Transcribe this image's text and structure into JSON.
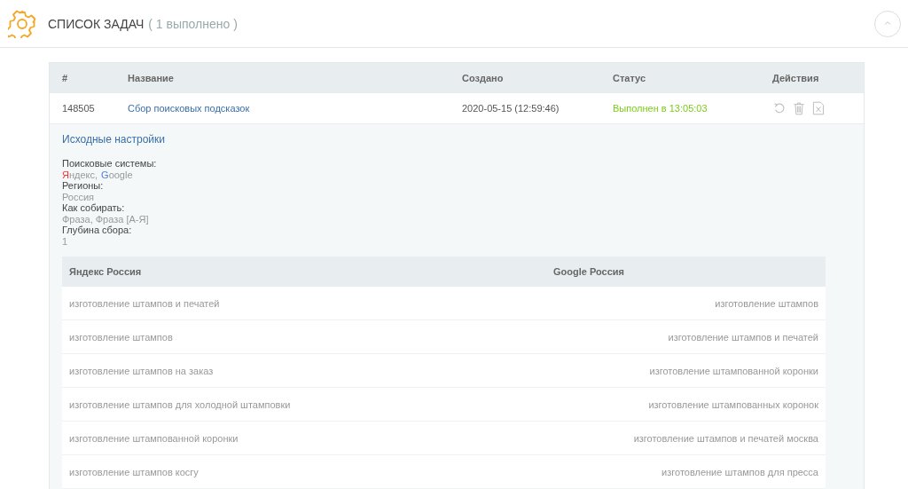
{
  "header": {
    "title": "СПИСОК ЗАДАЧ",
    "count": "( 1 выполнено )",
    "collapse_button": {
      "kind": "up"
    }
  },
  "tasks": {
    "columns": [
      "#",
      "Название",
      "Создано",
      "Статус",
      "Действия"
    ],
    "rows": [
      {
        "id": "148505",
        "name": "Сбор поисковых подсказок",
        "created": "2020-05-15 (12:59:46)",
        "status": {
          "text": "Выполнен в 13:05:03",
          "kind": "done"
        },
        "expanded": true,
        "details": {
          "heading": "Исходные настройки",
          "settings": [
            {
              "label": "Поисковые системы:",
              "kind": "engines",
              "engines": [
                {
                  "initial": "Я",
                  "rest": "ндекс,",
                  "color": "#ff3333"
                },
                {
                  "initial": "G",
                  "rest": "oogle",
                  "color": "#4a7fd8"
                }
              ]
            },
            {
              "label": "Регионы:",
              "kind": "text",
              "value": "Россия"
            },
            {
              "label": "Как собирать:",
              "kind": "text",
              "value": "Фраза, Фраза [А-Я]"
            },
            {
              "label": "Глубина сбора:",
              "kind": "text",
              "value": "1"
            }
          ],
          "results": {
            "columns": [
              "Яндекс Россия",
              "Google Россия"
            ],
            "rows": [
              [
                "изготовление штампов и печатей",
                "изготовление штампов"
              ],
              [
                "изготовление штампов",
                "изготовление штампов и печатей"
              ],
              [
                "изготовление штампов на заказ",
                "изготовление штампованной коронки"
              ],
              [
                "изготовление штампов для холодной штамповки",
                "изготовление штампованных коронок"
              ],
              [
                "изготовление штампованной коронки",
                "изготовление штампов и печатей москва"
              ],
              [
                "изготовление штампов косгу",
                "изготовление штампов для пресса"
              ]
            ]
          }
        }
      }
    ]
  }
}
